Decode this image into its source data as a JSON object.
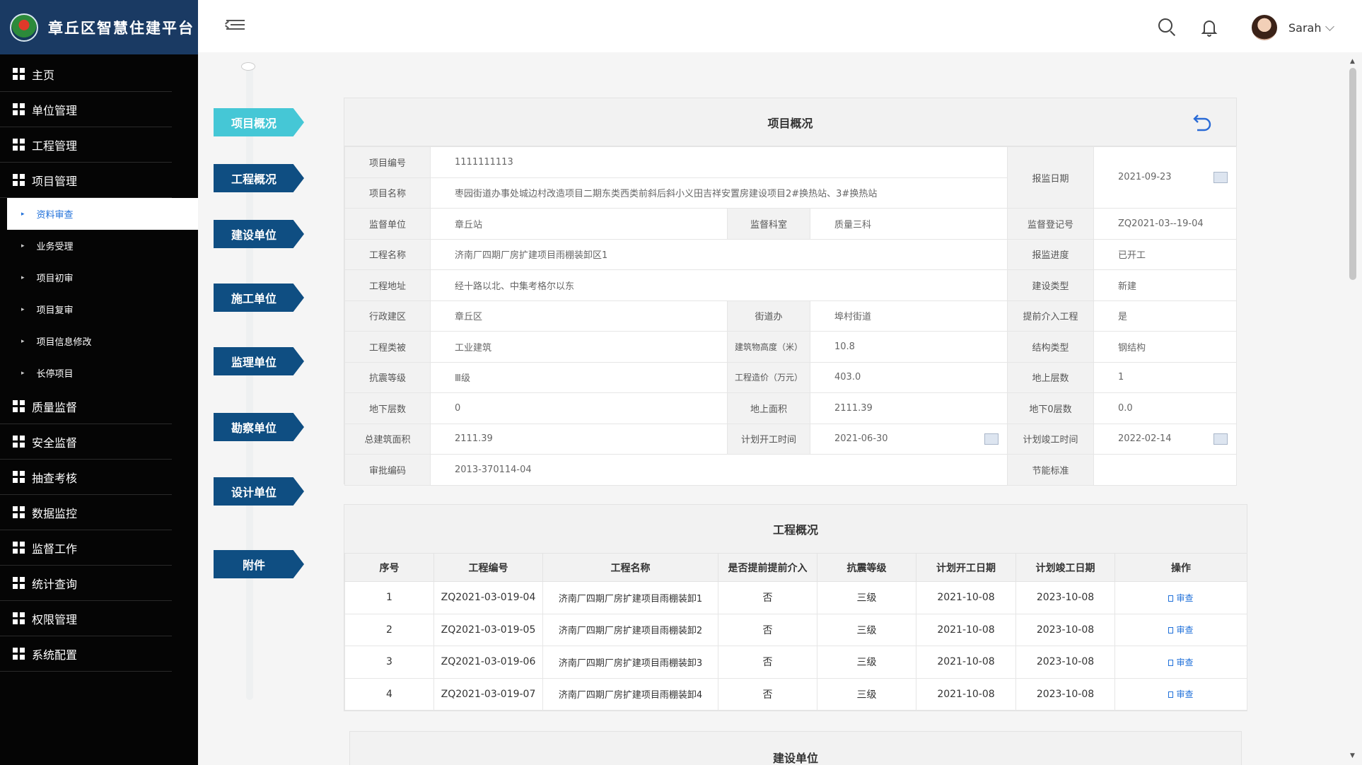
{
  "app": {
    "title": "章丘区智慧住建平台"
  },
  "sidebar": {
    "items_top": [
      {
        "label": "主页"
      },
      {
        "label": "单位管理"
      },
      {
        "label": "工程管理"
      },
      {
        "label": "项目管理"
      }
    ],
    "subitems": [
      {
        "label": "资料审查",
        "active": true
      },
      {
        "label": "业务受理"
      },
      {
        "label": "项目初审"
      },
      {
        "label": "项目复审"
      },
      {
        "label": "项目信息修改"
      },
      {
        "label": "长停项目"
      }
    ],
    "items_bottom": [
      {
        "label": "质量监督"
      },
      {
        "label": "安全监督"
      },
      {
        "label": "抽查考核"
      },
      {
        "label": "数据监控"
      },
      {
        "label": "监督工作"
      },
      {
        "label": "统计查询"
      },
      {
        "label": "权限管理"
      },
      {
        "label": "系统配置"
      }
    ]
  },
  "header": {
    "user_name": "Sarah"
  },
  "steps": [
    "项目概况",
    "工程概况",
    "建设单位",
    "施工单位",
    "监理单位",
    "勘察单位",
    "设计单位",
    "附件"
  ],
  "project": {
    "title": "项目概况",
    "labels": {
      "code": "项目编号",
      "name": "项目名称",
      "report_date": "报监日期",
      "supervise_unit": "监督单位",
      "supervise_dept": "监督科室",
      "reg_no": "监督登记号",
      "eng_name": "工程名称",
      "progress": "报监进度",
      "address": "工程地址",
      "build_type": "建设类型",
      "district": "行政建区",
      "street": "街道办",
      "early": "提前介入工程",
      "eng_category": "工程类被",
      "height": "建筑物高度（米）",
      "structure": "结构类型",
      "seismic": "抗震等级",
      "cost": "工程造价（万元）",
      "floors_above": "地上层数",
      "floors_below": "地下层数",
      "area_above": "地上面积",
      "area_below": "地下0层数",
      "total_area": "总建筑面积",
      "plan_start": "计划开工时间",
      "plan_end": "计划竣工时间",
      "approval_no": "审批编码",
      "energy": "节能标准"
    },
    "values": {
      "code": "1111111113",
      "name": "枣园街道办事处城边村改造项目二期东类西类前斜后斜小义田吉祥安置房建设项目2#换热站、3#换热站",
      "report_date": "2021-09-23",
      "supervise_unit": "章丘站",
      "supervise_dept": "质量三科",
      "reg_no": "ZQ2021-03--19-04",
      "eng_name": "济南厂四期厂房扩建项目雨棚装卸区1",
      "progress": "已开工",
      "address": "经十路以北、中集考格尔以东",
      "build_type": "新建",
      "district": "章丘区",
      "street": "埠村街道",
      "early": "是",
      "eng_category": "工业建筑",
      "height": "10.8",
      "structure": "钢结构",
      "seismic": "Ⅲ级",
      "cost": "403.0",
      "floors_above": "1",
      "floors_below": "0",
      "area_above": "2111.39",
      "area_below": "0.0",
      "total_area": "2111.39",
      "plan_start": "2021-06-30",
      "plan_end": "2022-02-14",
      "approval_no": "2013-370114-04",
      "energy": ""
    }
  },
  "engineering": {
    "title": "工程概况",
    "columns": [
      "序号",
      "工程编号",
      "工程名称",
      "是否提前提前介入",
      "抗震等级",
      "计划开工日期",
      "计划竣工日期",
      "操作"
    ],
    "rows": [
      {
        "no": "1",
        "code": "ZQ2021-03-019-04",
        "name": "济南厂四期厂房扩建项目雨棚装卸1",
        "early": "否",
        "seismic": "三级",
        "start": "2021-10-08",
        "end": "2023-10-08",
        "action": "审查"
      },
      {
        "no": "2",
        "code": "ZQ2021-03-019-05",
        "name": "济南厂四期厂房扩建项目雨棚装卸2",
        "early": "否",
        "seismic": "三级",
        "start": "2021-10-08",
        "end": "2023-10-08",
        "action": "审查"
      },
      {
        "no": "3",
        "code": "ZQ2021-03-019-06",
        "name": "济南厂四期厂房扩建项目雨棚装卸3",
        "early": "否",
        "seismic": "三级",
        "start": "2021-10-08",
        "end": "2023-10-08",
        "action": "审查"
      },
      {
        "no": "4",
        "code": "ZQ2021-03-019-07",
        "name": "济南厂四期厂房扩建项目雨棚装卸4",
        "early": "否",
        "seismic": "三级",
        "start": "2021-10-08",
        "end": "2023-10-08",
        "action": "审查"
      }
    ]
  },
  "construction": {
    "title": "建设单位"
  }
}
